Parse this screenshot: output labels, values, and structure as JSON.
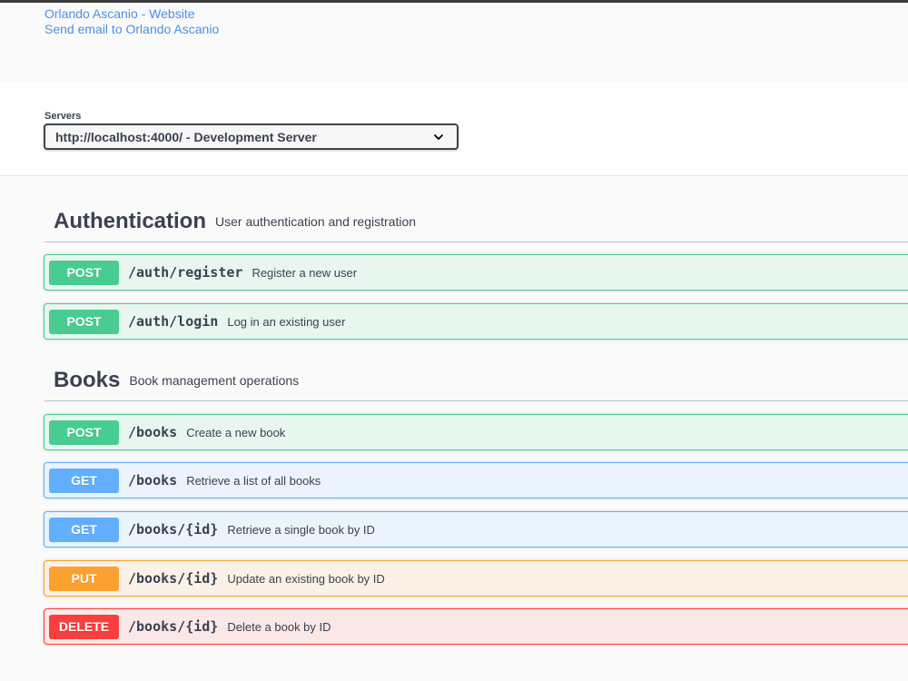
{
  "info": {
    "website_link": "Orlando Ascanio - Website",
    "email_link": "Send email to Orlando Ascanio"
  },
  "servers": {
    "label": "Servers",
    "selected": "http://localhost:4000/ - Development Server"
  },
  "tags": [
    {
      "name": "Authentication",
      "description": "User authentication and registration",
      "operations": [
        {
          "method": "POST",
          "path": "/auth/register",
          "summary": "Register a new user"
        },
        {
          "method": "POST",
          "path": "/auth/login",
          "summary": "Log in an existing user"
        }
      ]
    },
    {
      "name": "Books",
      "description": "Book management operations",
      "operations": [
        {
          "method": "POST",
          "path": "/books",
          "summary": "Create a new book"
        },
        {
          "method": "GET",
          "path": "/books",
          "summary": "Retrieve a list of all books"
        },
        {
          "method": "GET",
          "path": "/books/{id}",
          "summary": "Retrieve a single book by ID"
        },
        {
          "method": "PUT",
          "path": "/books/{id}",
          "summary": "Update an existing book by ID"
        },
        {
          "method": "DELETE",
          "path": "/books/{id}",
          "summary": "Delete a book by ID"
        }
      ]
    }
  ],
  "colors": {
    "post": "#49cc90",
    "get": "#61affe",
    "put": "#fca130",
    "delete": "#f93e3e",
    "link": "#4990e2"
  },
  "icons": {
    "select_arrow": "chevron-down-icon"
  }
}
